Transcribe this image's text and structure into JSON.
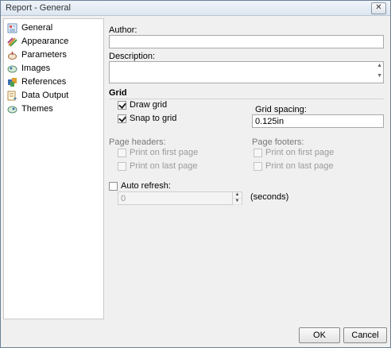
{
  "window": {
    "title": "Report - General",
    "close_label": "✕"
  },
  "sidebar": {
    "items": [
      {
        "label": "General",
        "icon": "general-icon"
      },
      {
        "label": "Appearance",
        "icon": "appearance-icon"
      },
      {
        "label": "Parameters",
        "icon": "parameters-icon"
      },
      {
        "label": "Images",
        "icon": "images-icon"
      },
      {
        "label": "References",
        "icon": "references-icon"
      },
      {
        "label": "Data Output",
        "icon": "data-output-icon"
      },
      {
        "label": "Themes",
        "icon": "themes-icon"
      }
    ]
  },
  "general": {
    "author_label": "Author:",
    "author_value": "",
    "description_label": "Description:",
    "description_value": "",
    "grid_heading": "Grid",
    "draw_grid_label": "Draw grid",
    "draw_grid_checked": true,
    "snap_to_grid_label": "Snap to grid",
    "snap_to_grid_checked": true,
    "grid_spacing_label": "Grid spacing:",
    "grid_spacing_value": "0.125in",
    "page_headers_label": "Page headers:",
    "headers_first_label": "Print on first page",
    "headers_last_label": "Print on last page",
    "page_footers_label": "Page footers:",
    "footers_first_label": "Print on first page",
    "footers_last_label": "Print on last page",
    "auto_refresh_label": "Auto refresh:",
    "auto_refresh_value": "0",
    "seconds_label": "(seconds)"
  },
  "footer": {
    "ok_label": "OK",
    "cancel_label": "Cancel"
  }
}
